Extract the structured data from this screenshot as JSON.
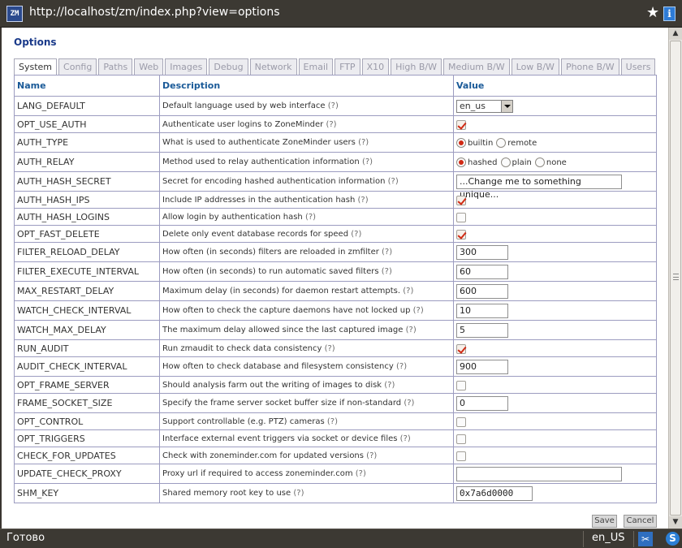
{
  "window": {
    "url": "http://localhost/zm/index.php?view=options",
    "app_icon": "ZM"
  },
  "page": {
    "title": "Options"
  },
  "tabs": [
    "System",
    "Config",
    "Paths",
    "Web",
    "Images",
    "Debug",
    "Network",
    "Email",
    "FTP",
    "X10",
    "High B/W",
    "Medium B/W",
    "Low B/W",
    "Phone B/W",
    "Users"
  ],
  "active_tab": "System",
  "table": {
    "headers": {
      "name": "Name",
      "description": "Description",
      "value": "Value"
    },
    "help_link": "(?)",
    "rows": [
      {
        "name": "LANG_DEFAULT",
        "desc": "Default language used by web interface"
      },
      {
        "name": "OPT_USE_AUTH",
        "desc": "Authenticate user logins to ZoneMinder"
      },
      {
        "name": "AUTH_TYPE",
        "desc": "What is used to authenticate ZoneMinder users"
      },
      {
        "name": "AUTH_RELAY",
        "desc": "Method used to relay authentication information"
      },
      {
        "name": "AUTH_HASH_SECRET",
        "desc": "Secret for encoding hashed authentication information"
      },
      {
        "name": "AUTH_HASH_IPS",
        "desc": "Include IP addresses in the authentication hash"
      },
      {
        "name": "AUTH_HASH_LOGINS",
        "desc": "Allow login by authentication hash"
      },
      {
        "name": "OPT_FAST_DELETE",
        "desc": "Delete only event database records for speed"
      },
      {
        "name": "FILTER_RELOAD_DELAY",
        "desc": "How often (in seconds) filters are reloaded in zmfilter"
      },
      {
        "name": "FILTER_EXECUTE_INTERVAL",
        "desc": "How often (in seconds) to run automatic saved filters"
      },
      {
        "name": "MAX_RESTART_DELAY",
        "desc": "Maximum delay (in seconds) for daemon restart attempts."
      },
      {
        "name": "WATCH_CHECK_INTERVAL",
        "desc": "How often to check the capture daemons have not locked up"
      },
      {
        "name": "WATCH_MAX_DELAY",
        "desc": "The maximum delay allowed since the last captured image"
      },
      {
        "name": "RUN_AUDIT",
        "desc": "Run zmaudit to check data consistency"
      },
      {
        "name": "AUDIT_CHECK_INTERVAL",
        "desc": "How often to check database and filesystem consistency"
      },
      {
        "name": "OPT_FRAME_SERVER",
        "desc": "Should analysis farm out the writing of images to disk"
      },
      {
        "name": "FRAME_SOCKET_SIZE",
        "desc": "Specify the frame server socket buffer size if non-standard"
      },
      {
        "name": "OPT_CONTROL",
        "desc": "Support controllable (e.g. PTZ) cameras"
      },
      {
        "name": "OPT_TRIGGERS",
        "desc": "Interface external event triggers via socket or device files"
      },
      {
        "name": "CHECK_FOR_UPDATES",
        "desc": "Check with zoneminder.com for updated versions"
      },
      {
        "name": "UPDATE_CHECK_PROXY",
        "desc": "Proxy url if required to access zoneminder.com"
      },
      {
        "name": "SHM_KEY",
        "desc": "Shared memory root key to use"
      }
    ]
  },
  "values": {
    "lang_default": "en_us",
    "opt_use_auth": true,
    "auth_type_options": {
      "builtin": "builtin",
      "remote": "remote"
    },
    "auth_type_selected": "builtin",
    "auth_relay_options": {
      "hashed": "hashed",
      "plain": "plain",
      "none": "none"
    },
    "auth_relay_selected": "hashed",
    "auth_hash_secret": "...Change me to something unique...",
    "auth_hash_ips": true,
    "auth_hash_logins": false,
    "opt_fast_delete": true,
    "filter_reload_delay": "300",
    "filter_execute_interval": "60",
    "max_restart_delay": "600",
    "watch_check_interval": "10",
    "watch_max_delay": "5",
    "run_audit": true,
    "audit_check_interval": "900",
    "opt_frame_server": false,
    "frame_socket_size": "0",
    "opt_control": false,
    "opt_triggers": false,
    "check_for_updates": false,
    "update_check_proxy": "",
    "shm_key": "0x7a6d0000"
  },
  "buttons": {
    "save": "Save",
    "cancel": "Cancel"
  },
  "statusbar": {
    "status": "Готово",
    "locale": "en_US"
  },
  "icons": {
    "star": "star-icon",
    "info": "info-icon",
    "tool": "tool-icon",
    "s": "s-icon"
  },
  "colors": {
    "accent": "#1a5a98",
    "checked": "#d02a14",
    "chrome": "#3c3933"
  }
}
